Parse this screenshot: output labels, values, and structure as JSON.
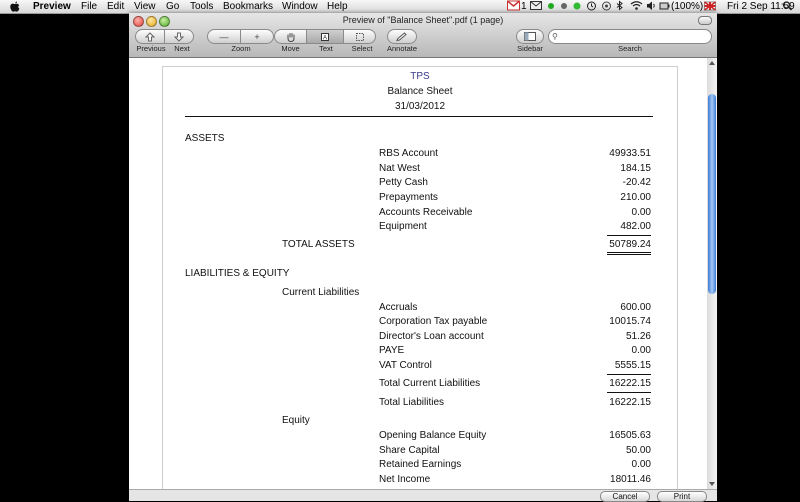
{
  "menubar": {
    "app": "Preview",
    "items": [
      "File",
      "Edit",
      "View",
      "Go",
      "Tools",
      "Bookmarks",
      "Window",
      "Help"
    ],
    "mail_count": "1",
    "battery": "(100%)",
    "clock": "Fri 2 Sep  11:59"
  },
  "window": {
    "title": "Preview of \"Balance Sheet\".pdf (1 page)",
    "toolbar": {
      "previous": "Previous",
      "next": "Next",
      "zoom": "Zoom",
      "move": "Move",
      "text": "Text",
      "select": "Select",
      "annotate": "Annotate",
      "sidebar": "Sidebar",
      "search": "Search",
      "search_value": ""
    },
    "buttons": {
      "cancel": "Cancel",
      "print": "Print"
    }
  },
  "document": {
    "company": "TPS",
    "title": "Balance Sheet",
    "date": "31/03/2012",
    "assets_heading": "ASSETS",
    "assets": [
      {
        "label": "RBS Account",
        "value": "49933.51"
      },
      {
        "label": "Nat West",
        "value": "184.15"
      },
      {
        "label": "Petty Cash",
        "value": "-20.42"
      },
      {
        "label": "Prepayments",
        "value": "210.00"
      },
      {
        "label": "Accounts Receivable",
        "value": "0.00"
      },
      {
        "label": "Equipment",
        "value": "482.00"
      }
    ],
    "total_assets": {
      "label": "TOTAL ASSETS",
      "value": "50789.24"
    },
    "liabilities_heading": "LIABILITIES & EQUITY",
    "current_liabilities_heading": "Current Liabilities",
    "current_liabilities": [
      {
        "label": "Accruals",
        "value": "600.00"
      },
      {
        "label": "Corporation Tax payable",
        "value": "10015.74"
      },
      {
        "label": "Director's Loan account",
        "value": "51.26"
      },
      {
        "label": "PAYE",
        "value": "0.00"
      },
      {
        "label": "VAT Control",
        "value": "5555.15"
      }
    ],
    "total_current_liabilities": {
      "label": "Total Current Liabilities",
      "value": "16222.15"
    },
    "total_liabilities": {
      "label": "Total Liabilities",
      "value": "16222.15"
    },
    "equity_heading": "Equity",
    "equity": [
      {
        "label": "Opening Balance Equity",
        "value": "16505.63"
      },
      {
        "label": "Share Capital",
        "value": "50.00"
      },
      {
        "label": "Retained Earnings",
        "value": "0.00"
      },
      {
        "label": "Net Income",
        "value": "18011.46"
      }
    ]
  }
}
